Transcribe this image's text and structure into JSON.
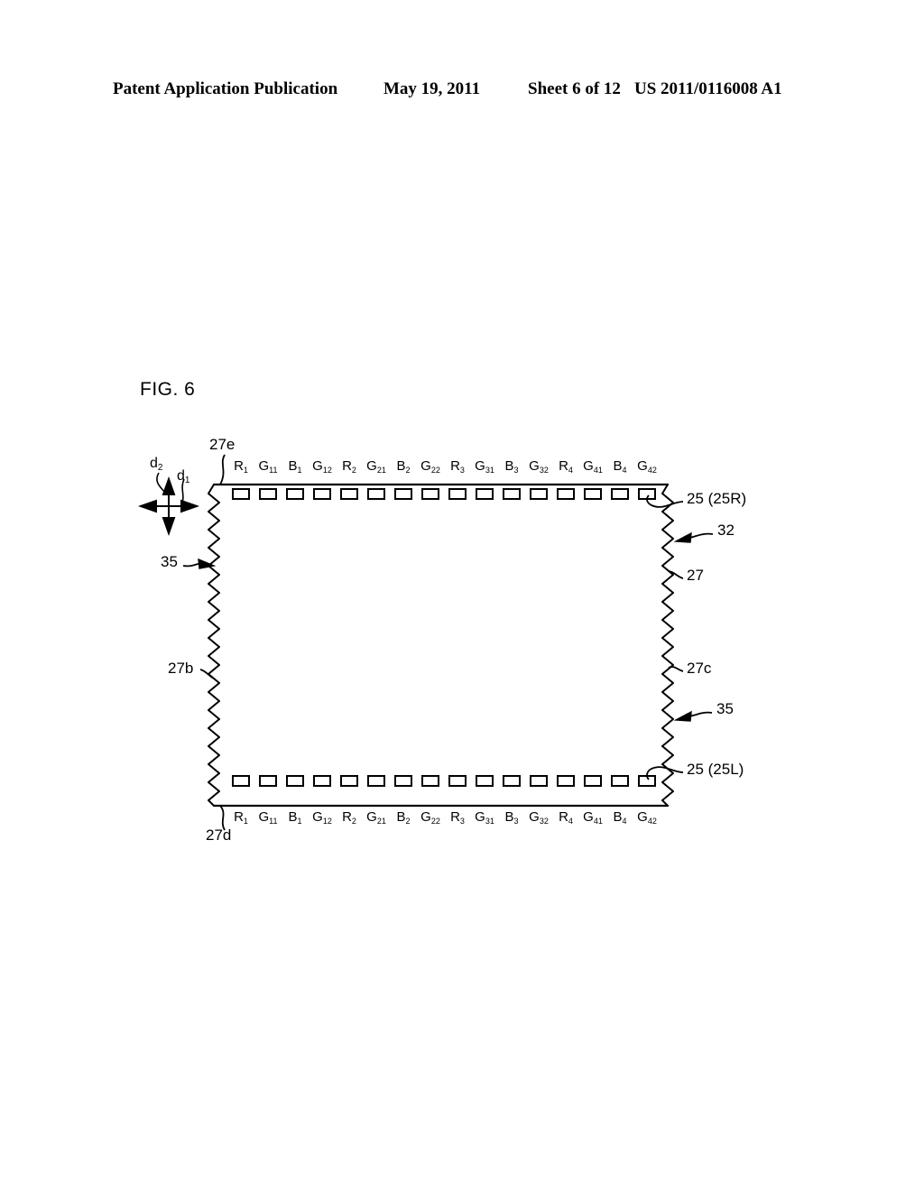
{
  "header": {
    "publication": "Patent Application Publication",
    "date": "May 19, 2011",
    "sheet": "Sheet 6 of 12",
    "document_number": "US 2011/0116008 A1"
  },
  "figure": {
    "label": "FIG. 6"
  },
  "dimension_arrows": {
    "vertical_label": "d",
    "vertical_sub": "2",
    "horizontal_label": "d",
    "horizontal_sub": "1"
  },
  "pad_labels_top": [
    {
      "base": "R",
      "sub": "1"
    },
    {
      "base": "G",
      "sub": "11"
    },
    {
      "base": "B",
      "sub": "1"
    },
    {
      "base": "G",
      "sub": "12"
    },
    {
      "base": "R",
      "sub": "2"
    },
    {
      "base": "G",
      "sub": "21"
    },
    {
      "base": "B",
      "sub": "2"
    },
    {
      "base": "G",
      "sub": "22"
    },
    {
      "base": "R",
      "sub": "3"
    },
    {
      "base": "G",
      "sub": "31"
    },
    {
      "base": "B",
      "sub": "3"
    },
    {
      "base": "G",
      "sub": "32"
    },
    {
      "base": "R",
      "sub": "4"
    },
    {
      "base": "G",
      "sub": "41"
    },
    {
      "base": "B",
      "sub": "4"
    },
    {
      "base": "G",
      "sub": "42"
    }
  ],
  "pad_labels_bottom": [
    {
      "base": "R",
      "sub": "1"
    },
    {
      "base": "G",
      "sub": "11"
    },
    {
      "base": "B",
      "sub": "1"
    },
    {
      "base": "G",
      "sub": "12"
    },
    {
      "base": "R",
      "sub": "2"
    },
    {
      "base": "G",
      "sub": "21"
    },
    {
      "base": "B",
      "sub": "2"
    },
    {
      "base": "G",
      "sub": "22"
    },
    {
      "base": "R",
      "sub": "3"
    },
    {
      "base": "G",
      "sub": "31"
    },
    {
      "base": "B",
      "sub": "3"
    },
    {
      "base": "G",
      "sub": "32"
    },
    {
      "base": "R",
      "sub": "4"
    },
    {
      "base": "G",
      "sub": "41"
    },
    {
      "base": "B",
      "sub": "4"
    },
    {
      "base": "G",
      "sub": "42"
    }
  ],
  "reference_numerals": {
    "top_edge": "27e",
    "bottom_edge": "27d",
    "left_edge": "27b",
    "right_edge_upper": "27",
    "right_edge_lower": "27c",
    "pads_right_top": "25 (25R)",
    "pads_right_bottom": "25 (25L)",
    "device": "32",
    "hatch_left": "35",
    "hatch_right": "35"
  },
  "colors": {
    "ink": "#000000",
    "paper": "#ffffff"
  }
}
